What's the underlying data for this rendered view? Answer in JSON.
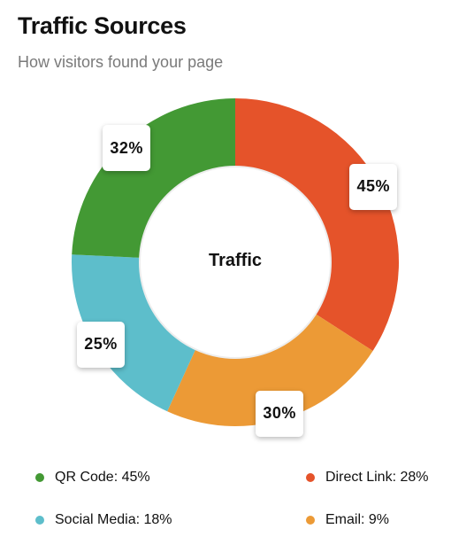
{
  "header": {
    "title": "Traffic Sources",
    "subtitle": "How visitors found your page"
  },
  "chart_data": {
    "type": "pie",
    "variant": "donut",
    "center_label": "Traffic",
    "start_angle_deg": -90,
    "slices": [
      {
        "label": "Direct Link",
        "value": 45,
        "display": "45%",
        "color": "#E5532A"
      },
      {
        "label": "Email",
        "value": 30,
        "display": "30%",
        "color": "#EC9A36"
      },
      {
        "label": "Social Media",
        "value": 25,
        "display": "25%",
        "color": "#5DBECB"
      },
      {
        "label": "QR Code",
        "value": 32,
        "display": "32%",
        "color": "#439934"
      }
    ],
    "legend": [
      {
        "text": "QR Code: 45%",
        "color": "#439934"
      },
      {
        "text": "Direct Link: 28%",
        "color": "#E5532A"
      },
      {
        "text": "Social Media: 18%",
        "color": "#5DBECB"
      },
      {
        "text": "Email: 9%",
        "color": "#EC9A36"
      }
    ]
  }
}
